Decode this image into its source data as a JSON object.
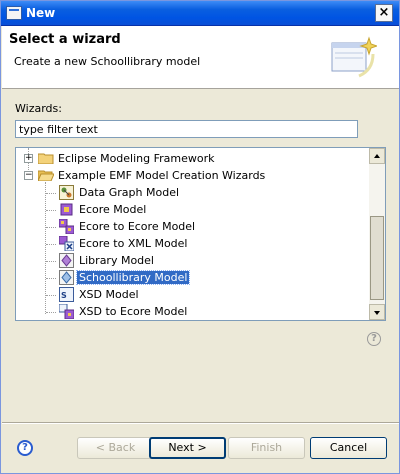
{
  "window": {
    "title": "New",
    "close_glyph": "×",
    "icon": "new-wizard-icon"
  },
  "banner": {
    "heading": "Select a wizard",
    "description": "Create a new Schoollibrary model",
    "icon": "wizard-sparkle-icon"
  },
  "wizards": {
    "label": "Wizards:",
    "filter_value": "type filter text",
    "tree": [
      {
        "label": "Eclipse Modeling Framework",
        "kind": "folder",
        "expanded": false,
        "icon": "folder-icon"
      },
      {
        "label": "Example EMF Model Creation Wizards",
        "kind": "folder",
        "expanded": true,
        "icon": "folder-open-icon"
      },
      {
        "label": "Data Graph Model",
        "kind": "item",
        "icon": "data-graph-icon"
      },
      {
        "label": "Ecore Model",
        "kind": "item",
        "icon": "ecore-icon"
      },
      {
        "label": "Ecore to Ecore Model",
        "kind": "item",
        "icon": "ecore-to-ecore-icon"
      },
      {
        "label": "Ecore to XML Model",
        "kind": "item",
        "icon": "ecore-to-xml-icon"
      },
      {
        "label": "Library Model",
        "kind": "item",
        "icon": "library-icon"
      },
      {
        "label": "Schoollibrary Model",
        "kind": "item",
        "icon": "schoollibrary-icon",
        "selected": true
      },
      {
        "label": "XSD Model",
        "kind": "item",
        "icon": "xsd-icon"
      },
      {
        "label": "XSD to Ecore Model",
        "kind": "item",
        "icon": "xsd-to-ecore-icon"
      }
    ]
  },
  "help_glyph": "?",
  "buttons": {
    "back": "< Back",
    "next": "Next >",
    "finish": "Finish",
    "cancel": "Cancel"
  },
  "colors": {
    "selection": "#316ac5",
    "titlebar": "#0054e3",
    "dialog_bg": "#ece9d8"
  }
}
